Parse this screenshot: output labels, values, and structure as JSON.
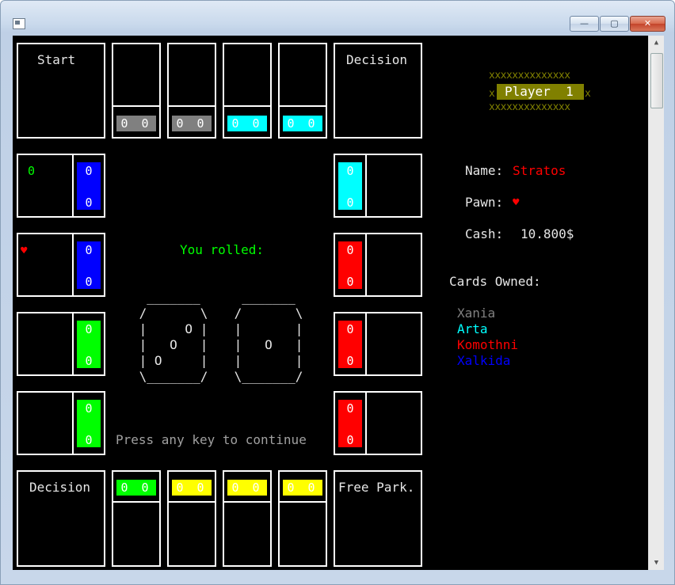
{
  "colors": {
    "gray": "#808080",
    "cyan": "#00ffff",
    "blue": "#0000ff",
    "red": "#ff0000",
    "green": "#00ff00",
    "yellow": "#ffff00",
    "olive": "#808000",
    "white": "#ffffff"
  },
  "board": {
    "corner_start": "Start",
    "corner_decision_top": "Decision",
    "corner_decision_bottom": "Decision",
    "corner_free_park": "Free Park.",
    "top_row_values": [
      "0 0",
      "0 0",
      "0 0",
      "0 0"
    ],
    "bottom_row_values": [
      "0 0",
      "0 0",
      "0 0",
      "0 0"
    ],
    "left_column_values": [
      [
        "0",
        "0"
      ],
      [
        "0",
        "0"
      ],
      [
        "0",
        "0"
      ],
      [
        "0",
        "0"
      ]
    ],
    "right_column_values": [
      [
        "0",
        "0"
      ],
      [
        "0",
        "0"
      ],
      [
        "0",
        "0"
      ],
      [
        "0",
        "0"
      ]
    ],
    "green_token": "0",
    "heart_token": "♥"
  },
  "center": {
    "rolled_label": "You rolled:",
    "die1": [
      "  _______",
      " /       \\",
      " |     O |",
      " |   O   |",
      " | O     |",
      " \\_______/"
    ],
    "die2": [
      "  _______",
      " /       \\",
      " |       |",
      " |   O   |",
      " |       |",
      " \\_______/"
    ],
    "continue_prompt": "Press any key to continue"
  },
  "player": {
    "banner_stars": "xxxxxxxxxxxxxx",
    "banner_side": "x",
    "banner_label": "Player  1",
    "name_label": "Name:",
    "name_value": "Stratos",
    "pawn_label": "Pawn:",
    "pawn_value": "♥",
    "cash_label": "Cash:",
    "cash_value": "10.800$",
    "cards_label": "Cards Owned:",
    "cards": [
      "Xania",
      "Arta",
      "Komothni",
      "Xalkida"
    ]
  },
  "window": {
    "minimize": "—",
    "maximize": "▢",
    "close": "✕",
    "scroll_up": "▲",
    "scroll_down": "▼"
  }
}
